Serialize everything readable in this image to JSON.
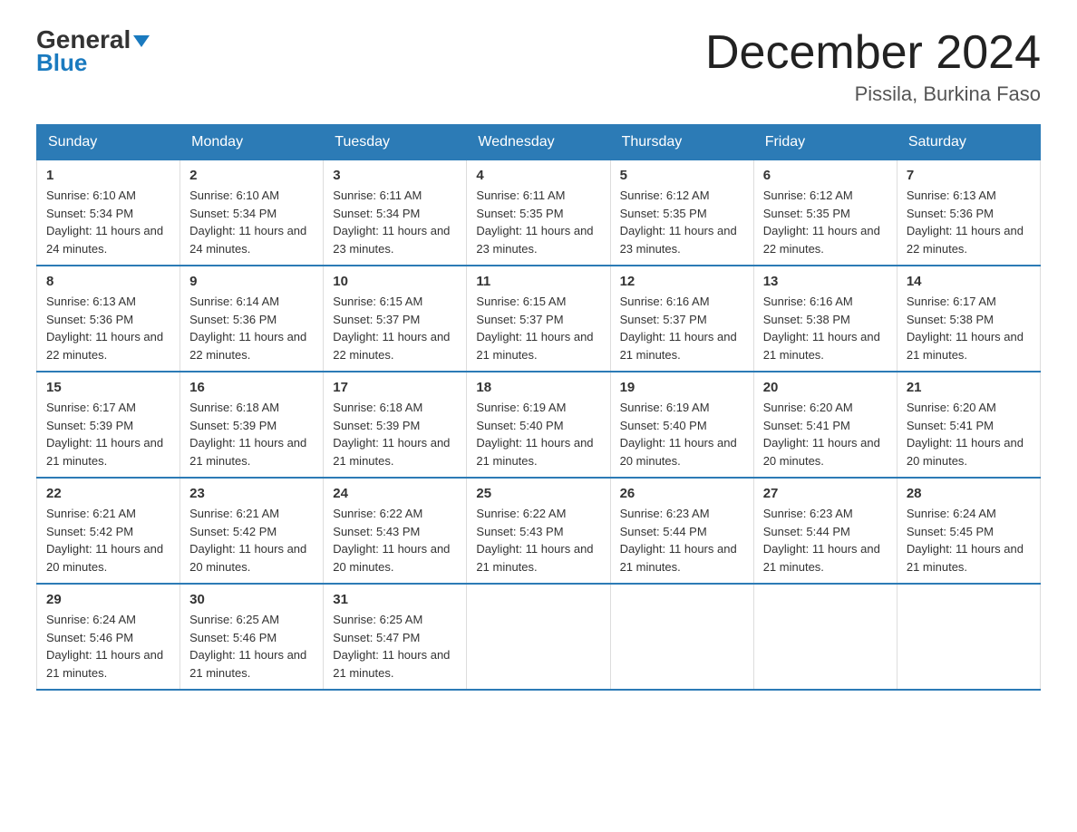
{
  "header": {
    "logo_line1": "General",
    "logo_line2": "Blue",
    "main_title": "December 2024",
    "subtitle": "Pissila, Burkina Faso"
  },
  "days_of_week": [
    "Sunday",
    "Monday",
    "Tuesday",
    "Wednesday",
    "Thursday",
    "Friday",
    "Saturday"
  ],
  "weeks": [
    [
      {
        "day": "1",
        "sunrise": "6:10 AM",
        "sunset": "5:34 PM",
        "daylight": "11 hours and 24 minutes."
      },
      {
        "day": "2",
        "sunrise": "6:10 AM",
        "sunset": "5:34 PM",
        "daylight": "11 hours and 24 minutes."
      },
      {
        "day": "3",
        "sunrise": "6:11 AM",
        "sunset": "5:34 PM",
        "daylight": "11 hours and 23 minutes."
      },
      {
        "day": "4",
        "sunrise": "6:11 AM",
        "sunset": "5:35 PM",
        "daylight": "11 hours and 23 minutes."
      },
      {
        "day": "5",
        "sunrise": "6:12 AM",
        "sunset": "5:35 PM",
        "daylight": "11 hours and 23 minutes."
      },
      {
        "day": "6",
        "sunrise": "6:12 AM",
        "sunset": "5:35 PM",
        "daylight": "11 hours and 22 minutes."
      },
      {
        "day": "7",
        "sunrise": "6:13 AM",
        "sunset": "5:36 PM",
        "daylight": "11 hours and 22 minutes."
      }
    ],
    [
      {
        "day": "8",
        "sunrise": "6:13 AM",
        "sunset": "5:36 PM",
        "daylight": "11 hours and 22 minutes."
      },
      {
        "day": "9",
        "sunrise": "6:14 AM",
        "sunset": "5:36 PM",
        "daylight": "11 hours and 22 minutes."
      },
      {
        "day": "10",
        "sunrise": "6:15 AM",
        "sunset": "5:37 PM",
        "daylight": "11 hours and 22 minutes."
      },
      {
        "day": "11",
        "sunrise": "6:15 AM",
        "sunset": "5:37 PM",
        "daylight": "11 hours and 21 minutes."
      },
      {
        "day": "12",
        "sunrise": "6:16 AM",
        "sunset": "5:37 PM",
        "daylight": "11 hours and 21 minutes."
      },
      {
        "day": "13",
        "sunrise": "6:16 AM",
        "sunset": "5:38 PM",
        "daylight": "11 hours and 21 minutes."
      },
      {
        "day": "14",
        "sunrise": "6:17 AM",
        "sunset": "5:38 PM",
        "daylight": "11 hours and 21 minutes."
      }
    ],
    [
      {
        "day": "15",
        "sunrise": "6:17 AM",
        "sunset": "5:39 PM",
        "daylight": "11 hours and 21 minutes."
      },
      {
        "day": "16",
        "sunrise": "6:18 AM",
        "sunset": "5:39 PM",
        "daylight": "11 hours and 21 minutes."
      },
      {
        "day": "17",
        "sunrise": "6:18 AM",
        "sunset": "5:39 PM",
        "daylight": "11 hours and 21 minutes."
      },
      {
        "day": "18",
        "sunrise": "6:19 AM",
        "sunset": "5:40 PM",
        "daylight": "11 hours and 21 minutes."
      },
      {
        "day": "19",
        "sunrise": "6:19 AM",
        "sunset": "5:40 PM",
        "daylight": "11 hours and 20 minutes."
      },
      {
        "day": "20",
        "sunrise": "6:20 AM",
        "sunset": "5:41 PM",
        "daylight": "11 hours and 20 minutes."
      },
      {
        "day": "21",
        "sunrise": "6:20 AM",
        "sunset": "5:41 PM",
        "daylight": "11 hours and 20 minutes."
      }
    ],
    [
      {
        "day": "22",
        "sunrise": "6:21 AM",
        "sunset": "5:42 PM",
        "daylight": "11 hours and 20 minutes."
      },
      {
        "day": "23",
        "sunrise": "6:21 AM",
        "sunset": "5:42 PM",
        "daylight": "11 hours and 20 minutes."
      },
      {
        "day": "24",
        "sunrise": "6:22 AM",
        "sunset": "5:43 PM",
        "daylight": "11 hours and 20 minutes."
      },
      {
        "day": "25",
        "sunrise": "6:22 AM",
        "sunset": "5:43 PM",
        "daylight": "11 hours and 21 minutes."
      },
      {
        "day": "26",
        "sunrise": "6:23 AM",
        "sunset": "5:44 PM",
        "daylight": "11 hours and 21 minutes."
      },
      {
        "day": "27",
        "sunrise": "6:23 AM",
        "sunset": "5:44 PM",
        "daylight": "11 hours and 21 minutes."
      },
      {
        "day": "28",
        "sunrise": "6:24 AM",
        "sunset": "5:45 PM",
        "daylight": "11 hours and 21 minutes."
      }
    ],
    [
      {
        "day": "29",
        "sunrise": "6:24 AM",
        "sunset": "5:46 PM",
        "daylight": "11 hours and 21 minutes."
      },
      {
        "day": "30",
        "sunrise": "6:25 AM",
        "sunset": "5:46 PM",
        "daylight": "11 hours and 21 minutes."
      },
      {
        "day": "31",
        "sunrise": "6:25 AM",
        "sunset": "5:47 PM",
        "daylight": "11 hours and 21 minutes."
      },
      null,
      null,
      null,
      null
    ]
  ],
  "labels": {
    "sunrise_prefix": "Sunrise: ",
    "sunset_prefix": "Sunset: ",
    "daylight_prefix": "Daylight: "
  }
}
